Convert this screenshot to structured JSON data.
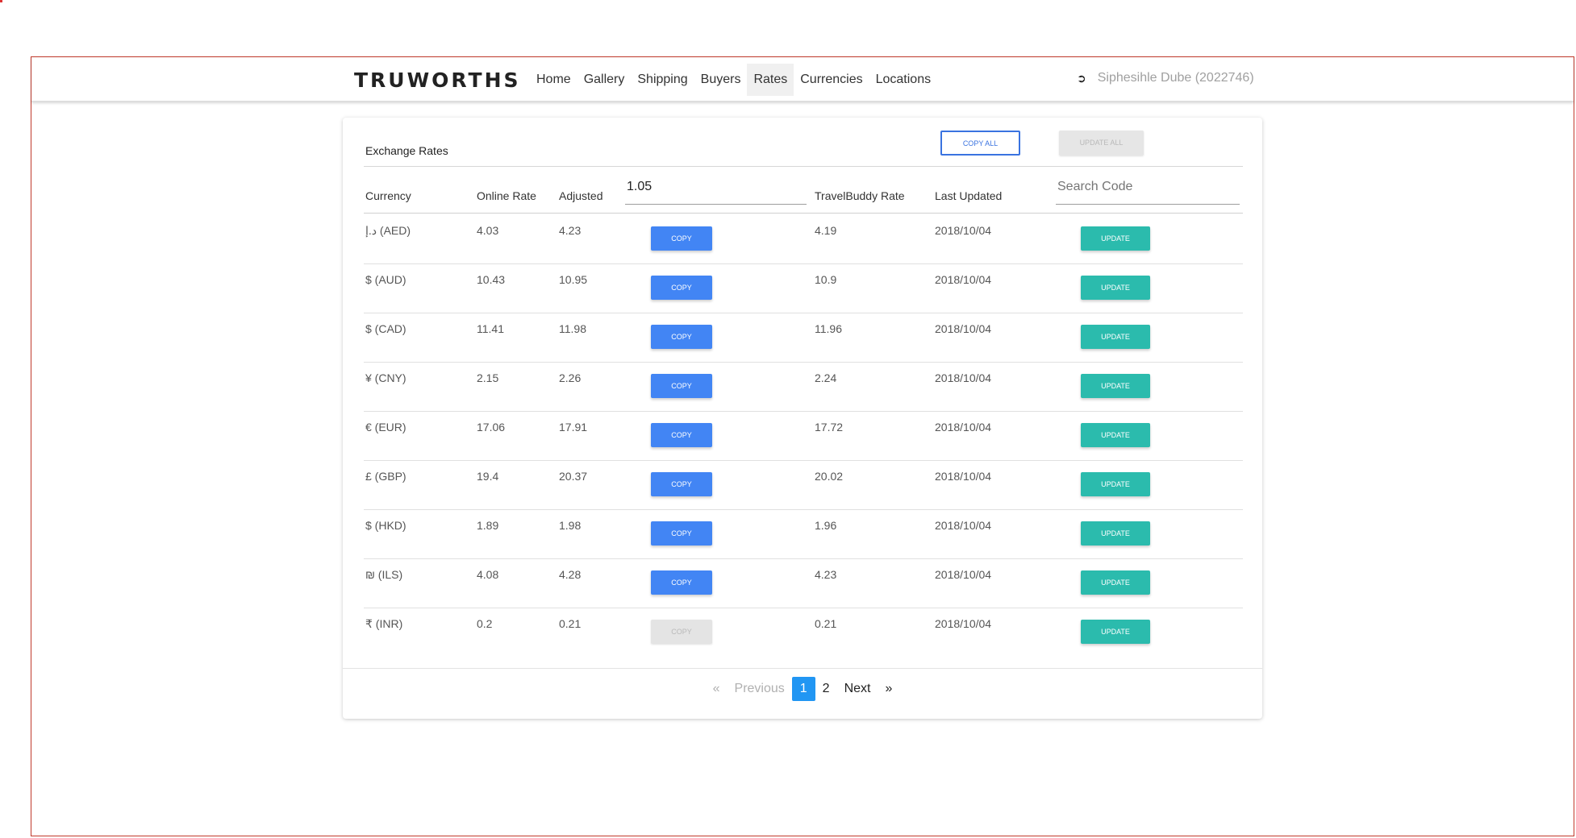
{
  "brand": "TRUWORTHS",
  "nav": [
    "Home",
    "Gallery",
    "Shipping",
    "Buyers",
    "Rates",
    "Currencies",
    "Locations"
  ],
  "nav_active": "Rates",
  "user": {
    "icon": "sign-out-icon",
    "name": "Siphesihle Dube (2022746)"
  },
  "card": {
    "title": "Exchange Rates",
    "copy_all_label": "COPY ALL",
    "update_all_label": "UPDATE ALL"
  },
  "table": {
    "headers": {
      "currency": "Currency",
      "online_rate": "Online Rate",
      "adjusted": "Adjusted",
      "travelbuddy_rate": "TravelBuddy Rate",
      "last_updated": "Last Updated"
    },
    "adjust_value": "1.05",
    "search_placeholder": "Search Code",
    "copy_label": "COPY",
    "update_label": "UPDATE",
    "rows": [
      {
        "currency": "د.إ (AED)",
        "online": "4.03",
        "adjusted": "4.23",
        "tb": "4.19",
        "updated": "2018/10/04",
        "copy_enabled": true
      },
      {
        "currency": "$ (AUD)",
        "online": "10.43",
        "adjusted": "10.95",
        "tb": "10.9",
        "updated": "2018/10/04",
        "copy_enabled": true
      },
      {
        "currency": "$ (CAD)",
        "online": "11.41",
        "adjusted": "11.98",
        "tb": "11.96",
        "updated": "2018/10/04",
        "copy_enabled": true
      },
      {
        "currency": "¥ (CNY)",
        "online": "2.15",
        "adjusted": "2.26",
        "tb": "2.24",
        "updated": "2018/10/04",
        "copy_enabled": true
      },
      {
        "currency": "€ (EUR)",
        "online": "17.06",
        "adjusted": "17.91",
        "tb": "17.72",
        "updated": "2018/10/04",
        "copy_enabled": true
      },
      {
        "currency": "£ (GBP)",
        "online": "19.4",
        "adjusted": "20.37",
        "tb": "20.02",
        "updated": "2018/10/04",
        "copy_enabled": true
      },
      {
        "currency": "$ (HKD)",
        "online": "1.89",
        "adjusted": "1.98",
        "tb": "1.96",
        "updated": "2018/10/04",
        "copy_enabled": true
      },
      {
        "currency": "₪ (ILS)",
        "online": "4.08",
        "adjusted": "4.28",
        "tb": "4.23",
        "updated": "2018/10/04",
        "copy_enabled": true
      },
      {
        "currency": "₹ (INR)",
        "online": "0.2",
        "adjusted": "0.21",
        "tb": "0.21",
        "updated": "2018/10/04",
        "copy_enabled": false
      }
    ]
  },
  "pagination": {
    "prev_arrow": "«",
    "prev": "Previous",
    "pages": [
      "1",
      "2"
    ],
    "current": "1",
    "next": "Next",
    "next_arrow": "»"
  }
}
